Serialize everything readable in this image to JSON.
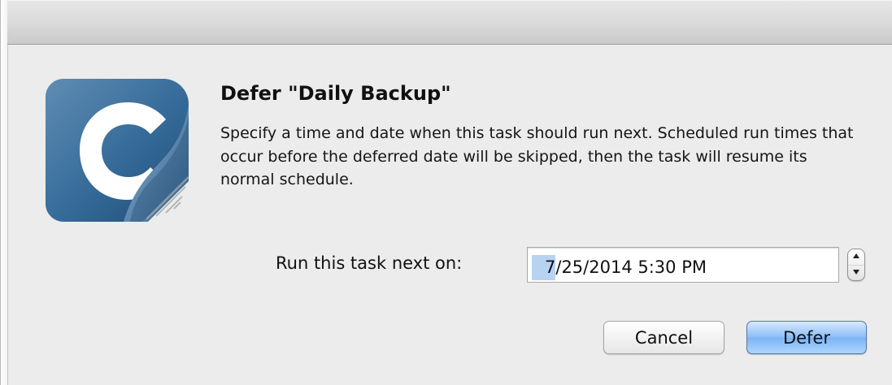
{
  "dialog": {
    "heading": "Defer \"Daily Backup\"",
    "message": "Specify a time and date when this task should run next. Scheduled run times that occur before the deferred date will be skipped, then the task will resume its normal schedule.",
    "icon": "carbon-copy-cloner-icon"
  },
  "date_picker": {
    "label": "Run this task next on:",
    "month": "7",
    "rest": "/25/2014   5:30  PM",
    "selected_component": "month",
    "stepper_up_icon": "stepper-up-arrow-icon",
    "stepper_down_icon": "stepper-down-arrow-icon"
  },
  "buttons": {
    "cancel_label": "Cancel",
    "defer_label": "Defer"
  },
  "colors": {
    "window_bg": "#ececec",
    "selection": "#b8d2f2",
    "default_button": "#7cb3f3"
  }
}
